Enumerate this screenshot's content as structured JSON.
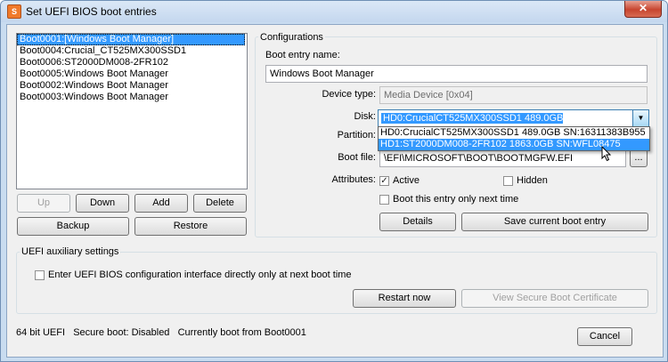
{
  "window": {
    "title": "Set UEFI BIOS boot entries",
    "close_glyph": "✕",
    "app_icon_glyph": "S"
  },
  "boot_list": {
    "items": [
      "Boot0001:[Windows Boot Manager]",
      "Boot0004:Crucial_CT525MX300SSD1",
      "Boot0006:ST2000DM008-2FR102",
      "Boot0005:Windows Boot Manager",
      "Boot0002:Windows Boot Manager",
      "Boot0003:Windows Boot Manager"
    ],
    "selected_index": 0
  },
  "list_buttons": {
    "up": "Up",
    "down": "Down",
    "add": "Add",
    "delete": "Delete",
    "backup": "Backup",
    "restore": "Restore"
  },
  "config": {
    "group_title": "Configurations",
    "entry_name_label": "Boot entry name:",
    "entry_name_value": "Windows Boot Manager",
    "device_type_label": "Device type:",
    "device_type_value": "Media Device [0x04]",
    "disk_label": "Disk:",
    "disk_value": "HD0:CrucialCT525MX300SSD1 489.0GB SN:16311383B955",
    "disk_options": [
      "HD0:CrucialCT525MX300SSD1 489.0GB SN:16311383B955",
      "HD1:ST2000DM008-2FR102 1863.0GB SN:WFL08475"
    ],
    "disk_highlighted_index": 1,
    "partition_label": "Partition:",
    "boot_file_label": "Boot file:",
    "boot_file_value": "\\EFI\\MICROSOFT\\BOOT\\BOOTMGFW.EFI",
    "browse_label": "...",
    "attributes_label": "Attributes:",
    "active_label": "Active",
    "active_checked": true,
    "hidden_label": "Hidden",
    "hidden_checked": false,
    "next_time_label": "Boot this entry only next time",
    "next_time_checked": false,
    "details_label": "Details",
    "save_label": "Save current boot entry"
  },
  "aux": {
    "group_title": "UEFI auxiliary settings",
    "enter_bios_label": "Enter UEFI BIOS configuration interface directly only at next boot time",
    "enter_bios_checked": false,
    "restart_label": "Restart now",
    "secure_cert_label": "View Secure Boot Certificate"
  },
  "status": {
    "text": "64 bit UEFI   Secure boot: Disabled   Currently boot from Boot0001"
  },
  "cancel_label": "Cancel",
  "colors": {
    "selection": "#3399ff",
    "frame": "#c9dcf0",
    "close_button": "#c7452f"
  }
}
